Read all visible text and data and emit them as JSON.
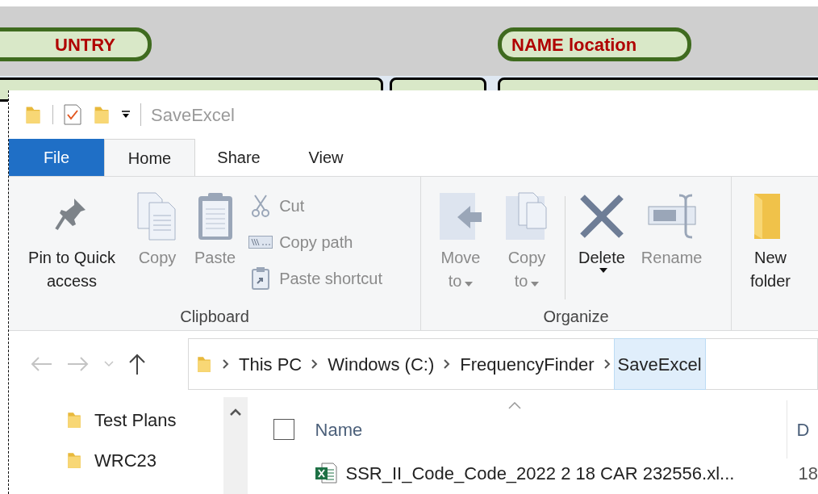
{
  "background_app": {
    "headers": [
      {
        "label": "UNTRY"
      },
      {
        "label": "NAME location"
      }
    ]
  },
  "window": {
    "title": "SaveExcel"
  },
  "tabs": [
    {
      "label": "File",
      "kind": "file",
      "selected": false
    },
    {
      "label": "Home",
      "kind": "tab",
      "selected": true
    },
    {
      "label": "Share",
      "kind": "tab",
      "selected": false
    },
    {
      "label": "View",
      "kind": "tab",
      "selected": false
    }
  ],
  "ribbon": {
    "groups": [
      {
        "label": "Clipboard",
        "items": [
          {
            "kind": "large",
            "label": "Pin to Quick access",
            "disabled": false
          },
          {
            "kind": "large",
            "label": "Copy",
            "disabled": true
          },
          {
            "kind": "large",
            "label": "Paste",
            "disabled": true
          },
          {
            "kind": "stack",
            "items": [
              {
                "label": "Cut",
                "disabled": true
              },
              {
                "label": "Copy path",
                "disabled": true
              },
              {
                "label": "Paste shortcut",
                "disabled": true
              }
            ]
          }
        ]
      },
      {
        "label": "Organize",
        "items": [
          {
            "kind": "large",
            "label": "Move to",
            "dropdown": true,
            "disabled": true
          },
          {
            "kind": "large",
            "label": "Copy to",
            "dropdown": true,
            "disabled": true
          },
          {
            "kind": "separator"
          },
          {
            "kind": "large",
            "label": "Delete",
            "dropdown": true,
            "disabled": false
          },
          {
            "kind": "large",
            "label": "Rename",
            "disabled": true
          }
        ]
      },
      {
        "items": [
          {
            "kind": "large",
            "label": "New folder",
            "disabled": false
          }
        ]
      }
    ]
  },
  "address": {
    "breadcrumbs": [
      {
        "label": "This PC",
        "selected": false
      },
      {
        "label": "Windows (C:)",
        "selected": false
      },
      {
        "label": "FrequencyFinder",
        "selected": false
      },
      {
        "label": "SaveExcel",
        "selected": true
      }
    ]
  },
  "nav_pane": {
    "items": [
      {
        "label": "Test Plans"
      },
      {
        "label": "WRC23"
      }
    ]
  },
  "file_list": {
    "select_all": {
      "checked": false
    },
    "columns": [
      {
        "label": "Name"
      },
      {
        "label": "D"
      }
    ],
    "rows": [
      {
        "name": "SSR_II_Code_Code_2022 2 18 CAR 232556.xl...",
        "column_2": "18"
      }
    ]
  }
}
